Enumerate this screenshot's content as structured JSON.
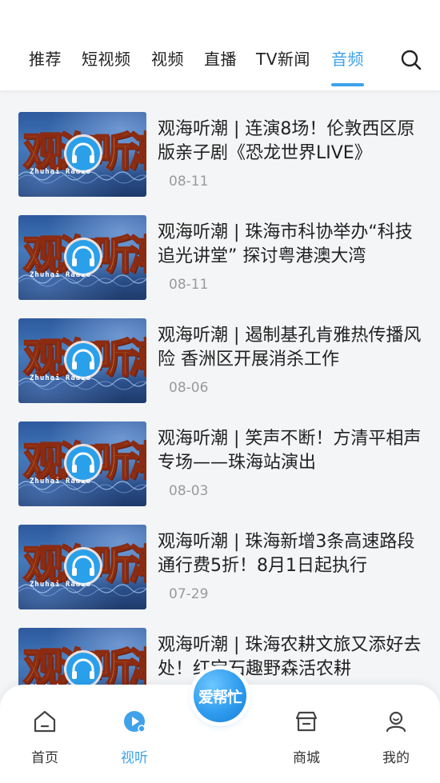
{
  "tabs": [
    {
      "label": "推荐"
    },
    {
      "label": "短视频"
    },
    {
      "label": "视频"
    },
    {
      "label": "直播"
    },
    {
      "label": "TV新闻"
    },
    {
      "label": "音频"
    }
  ],
  "active_tab": "音频",
  "accent_color": "#3fa2ea",
  "items": [
    {
      "title": "观海听潮 | 连演8场！伦敦西区原版亲子剧《恐龙世界LIVE》",
      "date": "08-11"
    },
    {
      "title": "观海听潮 | 珠海市科协举办“科技追光讲堂” 探讨粤港澳大湾",
      "date": "08-11"
    },
    {
      "title": "观海听潮 | 遏制基孔肯雅热传播风险 香洲区开展消杀工作",
      "date": "08-06"
    },
    {
      "title": "观海听潮 | 笑声不断！方清平相声专场——珠海站演出",
      "date": "08-03"
    },
    {
      "title": "观海听潮 | 珠海新增3条高速路段通行费5折！8月1日起执行",
      "date": "07-29"
    },
    {
      "title": "观海听潮 | 珠海农耕文旅又添好去处！红宝石趣野森活农耕",
      "date": ""
    }
  ],
  "thumbnail": {
    "logo": "观海听潮",
    "sub": "Zhuhai Radio",
    "icon": "headphones-icon"
  },
  "bottom_nav": {
    "home": "首页",
    "listen": "视听",
    "center": "爱帮忙",
    "mall": "商城",
    "mine": "我的"
  }
}
